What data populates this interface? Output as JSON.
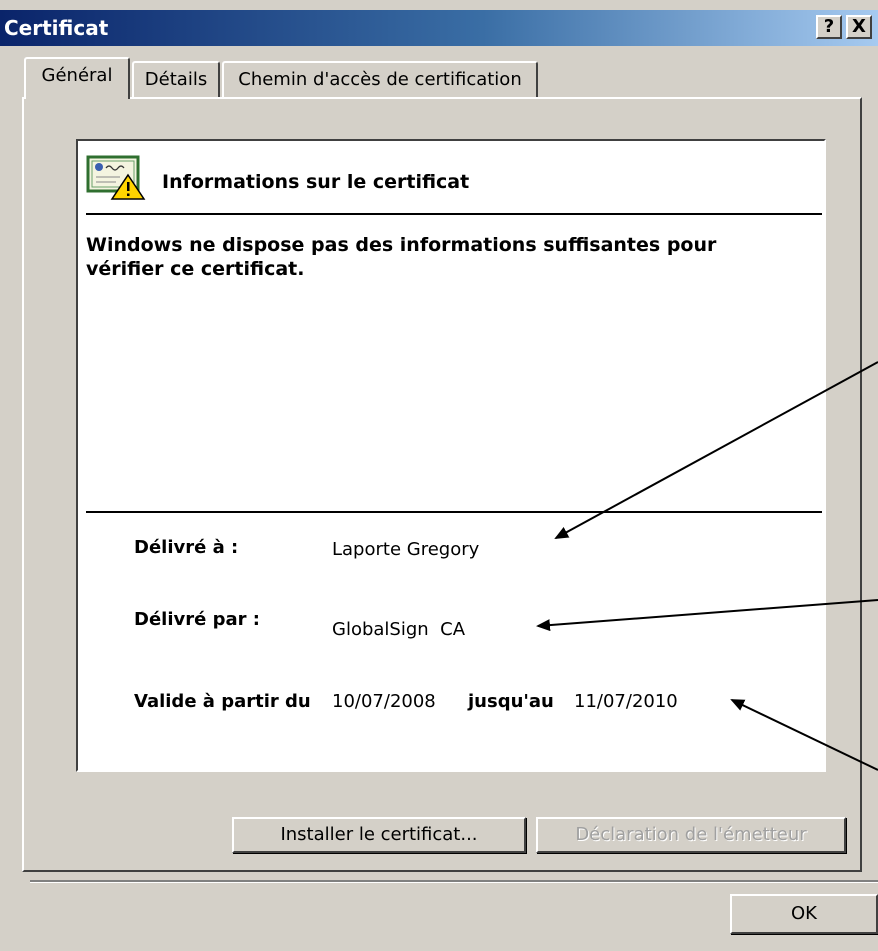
{
  "window": {
    "title": "Certificat",
    "help_label": "?",
    "close_label": "X"
  },
  "tabs": [
    {
      "label": "Général",
      "selected": true
    },
    {
      "label": "Détails",
      "selected": false
    },
    {
      "label": "Chemin d'accès de certification",
      "selected": false
    }
  ],
  "info": {
    "title": "Informations sur le certificat",
    "warning_line1": "Windows ne dispose pas des informations suffisantes pour",
    "warning_line2": "vérifier ce certificat.",
    "issued_to_label": "Délivré à :",
    "issued_to_value": "Laporte Gregory",
    "issued_by_label": "Délivré par :",
    "issued_by_value": "GlobalSign  CA",
    "valid_from_label": "Valide à partir du",
    "valid_from_value": "10/07/2008",
    "valid_to_label": "jusqu'au",
    "valid_to_value": "11/07/2010"
  },
  "buttons": {
    "install": "Installer le certificat...",
    "declaration": "Déclaration de l'émetteur",
    "ok": "OK"
  },
  "icons": {
    "certificate": "certificate-warning-icon"
  },
  "colors": {
    "titlebar_start": "#0a246a",
    "titlebar_end": "#a6caf0",
    "face": "#d4d0c8"
  }
}
